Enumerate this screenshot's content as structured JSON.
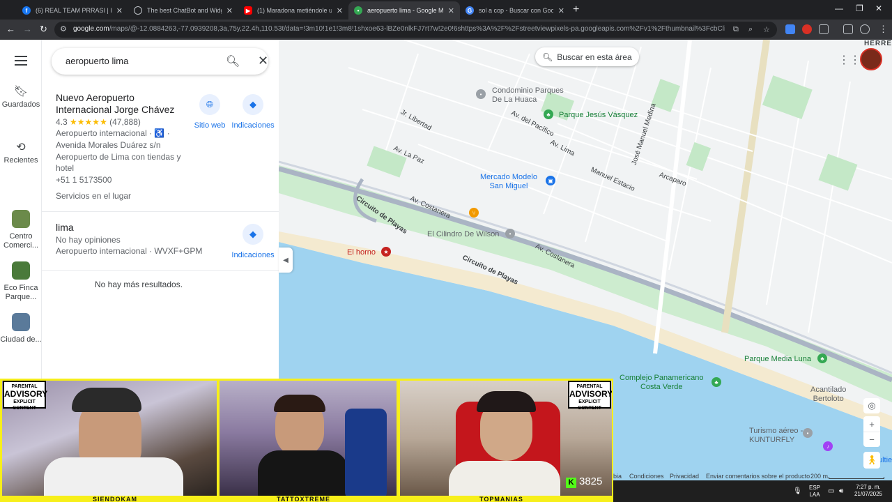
{
  "browser": {
    "tabs": [
      {
        "title": "(6) REAL TEAM PRRASI | Facebo",
        "favicon_color": "#1877f2",
        "active": false
      },
      {
        "title": "The best ChatBot and Widgets",
        "favicon_color": "#5f6368",
        "active": false
      },
      {
        "title": "(1) Maradona metiéndole un g",
        "favicon_color": "#ff0000",
        "active": false
      },
      {
        "title": "aeropuerto lima - Google Maps",
        "favicon_color": "#34a853",
        "active": true
      },
      {
        "title": "sol a cop - Buscar con Google",
        "favicon_color": "#4285f4",
        "active": false
      }
    ],
    "new_tab_icon": "plus-icon",
    "url_host": "google.com",
    "url_rest": "/maps/@-12.0884263,-77.0939208,3a,75y,22.4h,110.53t/data=!3m10!1e1!3m8!1shxoe63-lBZe0nlkFJ7rt7w!2e0!6shttps%3A%2F%2Fstreetviewpixels-pa.googleapis.com%2Fv1%2Fthumbnail%3FcbClient%3Dmaps_sv.tactil..."
  },
  "maps": {
    "rail": {
      "menu_icon": "menu-icon",
      "items": [
        {
          "label": "Guardados",
          "icon": "bookmark-icon"
        },
        {
          "label": "Recientes",
          "icon": "history-icon"
        },
        {
          "label": "Centro Comerci...",
          "thumb_color": "#6b8a4a"
        },
        {
          "label": "Eco Finca Parque...",
          "thumb_color": "#4a7a3a"
        },
        {
          "label": "Ciudad de...",
          "thumb_color": "#5a7a9a"
        }
      ]
    },
    "search": {
      "value": "aeropuerto lima"
    },
    "results": [
      {
        "name": "Nuevo Aeropuerto Internacional Jorge Chávez",
        "rating": "4.3",
        "stars": "★★★★★",
        "reviews": "(47,888)",
        "category": "Aeropuerto internacional · ♿ ·",
        "address": "Avenida Morales Duárez s/n",
        "description_1": "Aeropuerto de Lima con tiendas y",
        "description_2": "hotel",
        "phone": "+51 1 5173500",
        "extra": "Servicios en el lugar",
        "action_website": "Sitio web",
        "action_directions": "Indicaciones"
      },
      {
        "name": "lima",
        "reviews_text": "No hay opiniones",
        "category": "Aeropuerto internacional · WVXF+GPM",
        "action_directions": "Indicaciones"
      }
    ],
    "no_more_results": "No hay más resultados.",
    "search_area_button": "Buscar en esta área",
    "labels": {
      "herre": "HERRE",
      "condominio": "Condominio Parques De La Huaca",
      "parque_jesus": "Parque Jesús Vásquez",
      "jr_libertad": "Jr. Libertad",
      "av_del_pacifico": "Av. del Pacífico",
      "av_la_paz": "Av. La Paz",
      "av_lima": "Av. Lima",
      "jose_manuel_medina": "José Manuel Medina",
      "mercado_1": "Mercado Modelo",
      "mercado_2": "San Miguel",
      "manuel_estacio": "Manuel Estacio",
      "arcaparo": "Arcaparo",
      "circuito_1": "Circuito de Playas",
      "circuito_2": "Circuito de Playas",
      "av_costanera_1": "Av. Costanera",
      "av_costanera_2": "Av. Costanera",
      "el_cilindro": "El Cilindro De Wilson",
      "el_horno": "El horno",
      "parque_media_luna": "Parque Media Luna",
      "complejo_1": "Complejo Panamericano",
      "complejo_2": "Costa Verde",
      "acantilado_1": "Acantilado",
      "acantilado_2": "Bertoloto",
      "turismo_1": "Turismo aéreo -",
      "turismo_2": "KUNTURFLY",
      "cultie": "ultie"
    },
    "footer": {
      "bia": "bia",
      "conditions": "Condiciones",
      "privacy": "Privacidad",
      "feedback": "Enviar comentarios sobre el producto",
      "scale": "200 m"
    }
  },
  "stream": {
    "streamers": [
      {
        "name": "SIENDOKAM"
      },
      {
        "name": "TATTOXTREME"
      },
      {
        "name": "TOPMANIAS"
      }
    ],
    "advisory_top": "PARENTAL",
    "advisory_mid": "ADVISORY",
    "advisory_bottom": "EXPLICIT CONTENT",
    "kick_logo": "K",
    "viewer_count": "3825"
  },
  "taskbar": {
    "lang_1": "ESP",
    "lang_2": "LAA",
    "time": "7:27 p. m.",
    "date": "21/07/2025"
  }
}
